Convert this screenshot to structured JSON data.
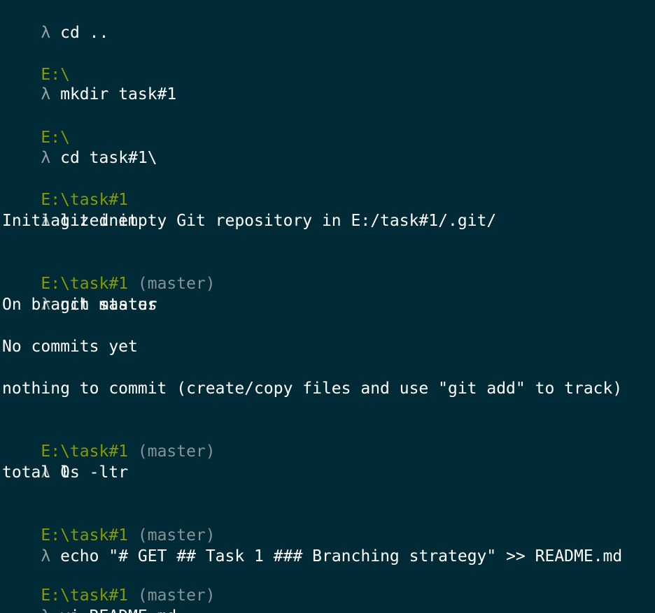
{
  "colors": {
    "background": "#002b36",
    "path": "#859900",
    "branch": "#839496",
    "prompt_symbol": "#93a1a1",
    "text": "#ffffff"
  },
  "prompt_symbol": "λ",
  "lines": [
    {
      "cmd": "cd .."
    },
    {
      "path": "E:\\"
    },
    {
      "cmd": "mkdir task#1"
    },
    {
      "path": "E:\\"
    },
    {
      "cmd": "cd task#1\\"
    },
    {
      "path": "E:\\task#1"
    },
    {
      "cmd": "git init"
    },
    {
      "out": "Initialized empty Git repository in E:/task#1/.git/"
    },
    {
      "path": "E:\\task#1",
      "branch": "(master)"
    },
    {
      "cmd": "git status"
    },
    {
      "out": "On branch master"
    },
    {
      "out": "No commits yet"
    },
    {
      "out": "nothing to commit (create/copy files and use \"git add\" to track)"
    },
    {
      "path": "E:\\task#1",
      "branch": "(master)"
    },
    {
      "cmd": "ls -ltr"
    },
    {
      "out": "total 0"
    },
    {
      "path": "E:\\task#1",
      "branch": "(master)"
    },
    {
      "cmd": "echo \"# GET ## Task 1 ### Branching strategy\" >> README.md"
    },
    {
      "path": "E:\\task#1",
      "branch": "(master)"
    },
    {
      "cmd": "vi README.md"
    }
  ]
}
